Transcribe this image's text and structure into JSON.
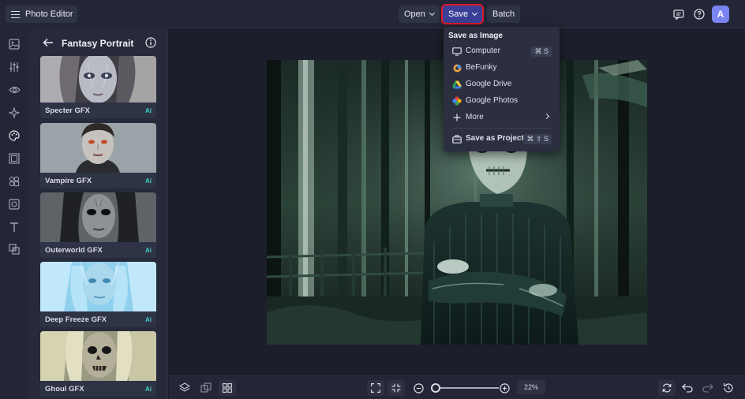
{
  "app": {
    "title": "Photo Editor"
  },
  "toolbar": {
    "open_label": "Open",
    "save_label": "Save",
    "batch_label": "Batch",
    "avatar_letter": "A"
  },
  "panel": {
    "title": "Fantasy Portrait",
    "items": [
      {
        "label": "Specter GFX",
        "badge": "Ai"
      },
      {
        "label": "Vampire GFX",
        "badge": "Ai"
      },
      {
        "label": "Outerworld GFX",
        "badge": "Ai"
      },
      {
        "label": "Deep Freeze GFX",
        "badge": "Ai"
      },
      {
        "label": "Ghoul GFX",
        "badge": "Ai"
      }
    ]
  },
  "save_menu": {
    "heading": "Save as Image",
    "items": [
      {
        "label": "Computer",
        "shortcut": "⌘ S",
        "icon": "monitor-icon"
      },
      {
        "label": "BeFunky",
        "icon": "befunky-icon"
      },
      {
        "label": "Google Drive",
        "icon": "google-drive-icon"
      },
      {
        "label": "Google Photos",
        "icon": "google-photos-icon"
      },
      {
        "label": "More",
        "icon": "plus-icon"
      }
    ],
    "project": {
      "label": "Save as Project",
      "shortcut": "⌘ ⇧ S",
      "icon": "briefcase-icon"
    }
  },
  "zoom": {
    "value": "22%",
    "level_fraction": 0.05
  },
  "colors": {
    "accent": "#3b3f98",
    "highlight": "#e0182a",
    "ai_badge": "#3fd0c5",
    "avatar": "#7b84f3"
  }
}
